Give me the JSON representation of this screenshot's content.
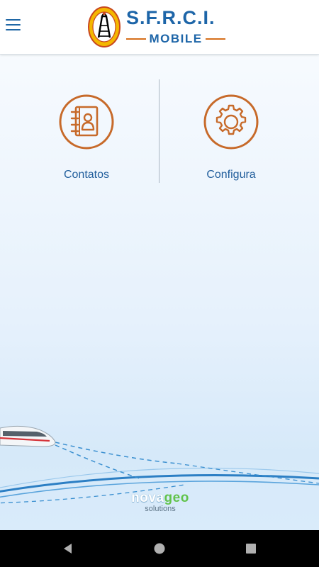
{
  "appbar": {
    "menu_icon": "hamburger-menu-icon",
    "logo_title": "S.F.R.C.I.",
    "logo_subtitle": "MOBILE",
    "brand_color": "#1d65a8",
    "accent_color": "#d66f1b"
  },
  "tiles": [
    {
      "label": "Contatos",
      "icon": "contacts-book-icon"
    },
    {
      "label": "Configura",
      "icon": "gear-settings-icon"
    }
  ],
  "footer": {
    "brand_part1": "nova",
    "brand_part2": "geo",
    "tagline": "solutions"
  },
  "navigation": {
    "back_icon": "back-triangle-icon",
    "home_icon": "home-circle-icon",
    "recent_icon": "recent-apps-square-icon"
  }
}
